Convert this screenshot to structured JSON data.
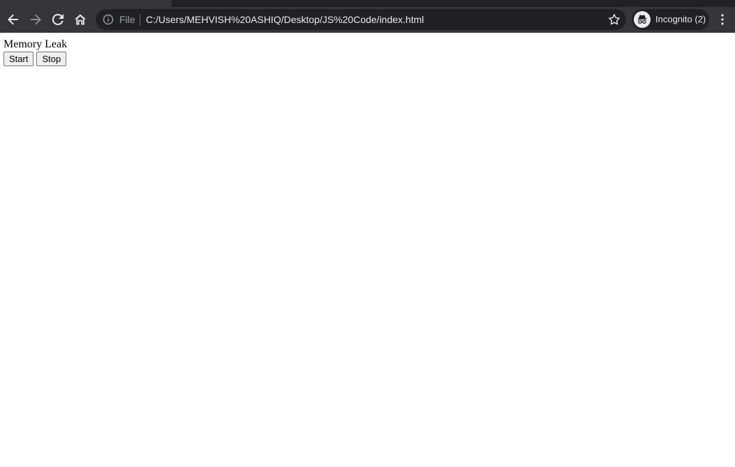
{
  "browser": {
    "nav": {
      "back_icon": "arrow-left-icon",
      "forward_icon": "arrow-right-icon",
      "reload_icon": "reload-icon",
      "home_icon": "home-icon"
    },
    "omnibox": {
      "scheme_label": "File",
      "url": "C:/Users/MEHVISH%20ASHIQ/Desktop/JS%20Code/index.html"
    },
    "profile": {
      "label": "Incognito (2)"
    },
    "colors": {
      "frame": "#35363a",
      "omnibox_bg": "#202124",
      "text": "#e8eaed",
      "muted": "#9aa0a6"
    }
  },
  "page": {
    "heading": "Memory Leak",
    "buttons": {
      "start_label": "Start",
      "stop_label": "Stop"
    }
  }
}
